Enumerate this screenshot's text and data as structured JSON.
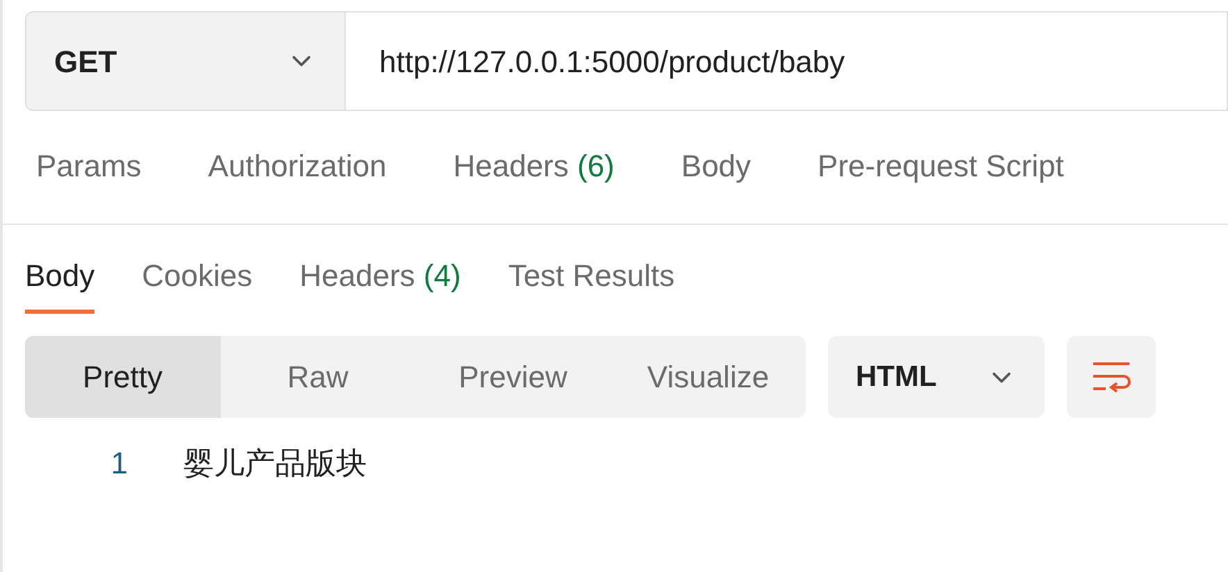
{
  "request": {
    "method": "GET",
    "url": "http://127.0.0.1:5000/product/baby"
  },
  "request_tabs": [
    {
      "label": "Params",
      "selected": false
    },
    {
      "label": "Authorization",
      "selected": false
    },
    {
      "label": "Headers",
      "count": "(6)",
      "selected": false
    },
    {
      "label": "Body",
      "selected": false
    },
    {
      "label": "Pre-request Script",
      "selected": false
    }
  ],
  "response_tabs": [
    {
      "label": "Body",
      "selected": true
    },
    {
      "label": "Cookies",
      "selected": false
    },
    {
      "label": "Headers",
      "count": "(4)",
      "selected": false
    },
    {
      "label": "Test Results",
      "selected": false
    }
  ],
  "view_modes": [
    {
      "label": "Pretty",
      "selected": true
    },
    {
      "label": "Raw",
      "selected": false
    },
    {
      "label": "Preview",
      "selected": false
    },
    {
      "label": "Visualize",
      "selected": false
    }
  ],
  "format": "HTML",
  "wrap_lines": true,
  "code_lines": [
    {
      "number": "1",
      "text": "婴儿产品版块"
    }
  ]
}
